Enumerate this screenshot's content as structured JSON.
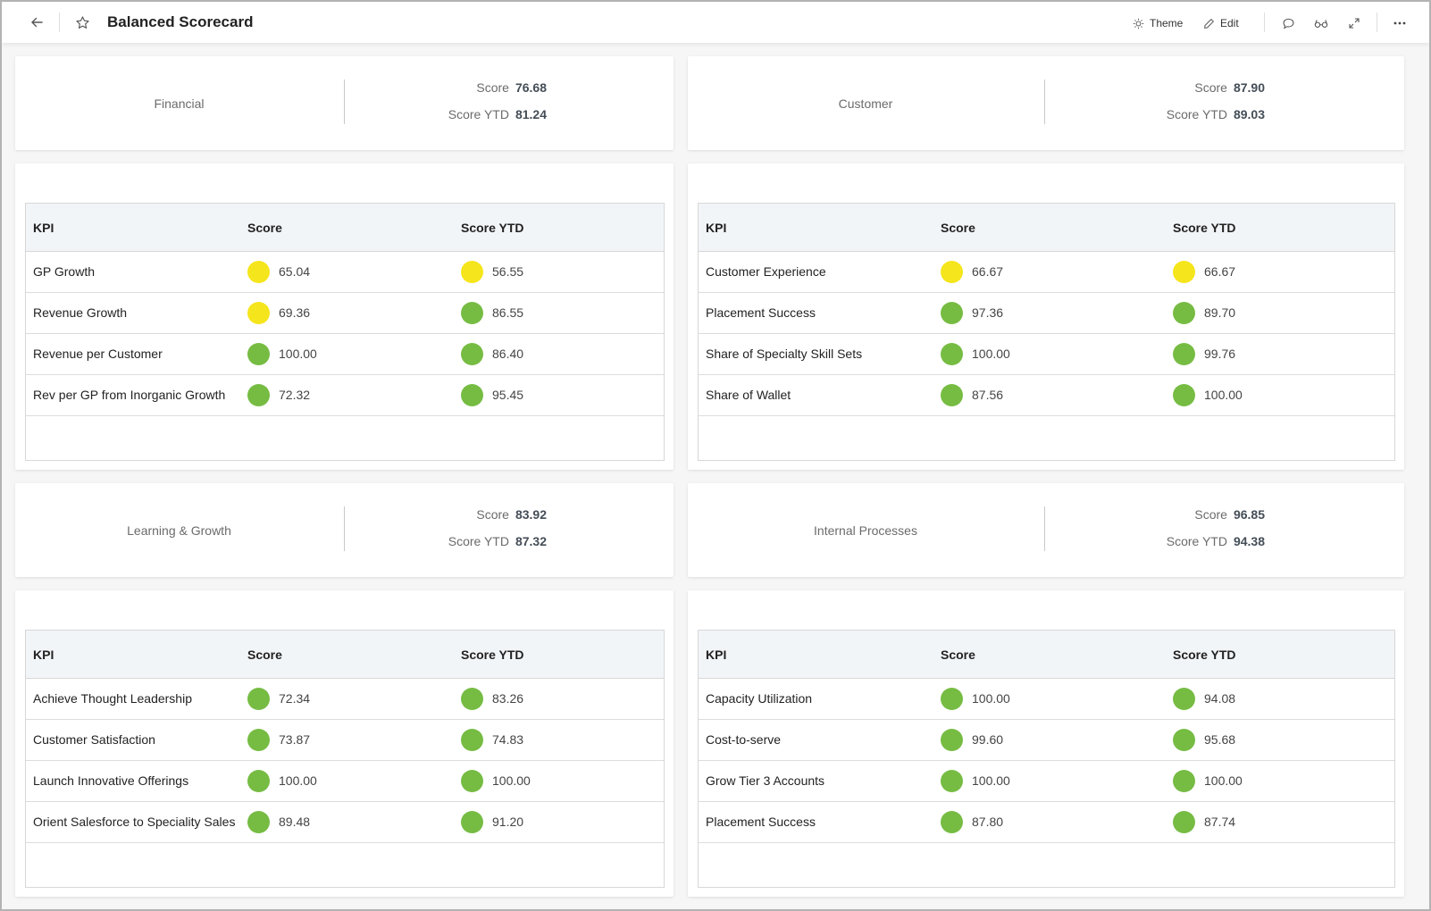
{
  "header": {
    "title": "Balanced Scorecard",
    "back_icon": "arrow-left-icon",
    "favorite_icon": "star-icon",
    "theme_label": "Theme",
    "edit_label": "Edit",
    "icons": [
      "sun-icon",
      "pencil-icon",
      "comment-icon",
      "glasses-icon",
      "expand-icon",
      "more-icon"
    ]
  },
  "colors": {
    "green": "#76bc43",
    "yellow": "#f5e51c",
    "header_bg": "#f2f5f8"
  },
  "columns": [
    "KPI",
    "Score",
    "Score YTD"
  ],
  "summary_labels": {
    "score": "Score",
    "score_ytd": "Score YTD"
  },
  "perspectives": [
    {
      "name": "Financial",
      "score": "76.68",
      "score_ytd": "81.24",
      "rows": [
        {
          "kpi": "GP Growth",
          "score": "65.04",
          "score_status": "yellow",
          "ytd": "56.55",
          "ytd_status": "yellow"
        },
        {
          "kpi": "Revenue Growth",
          "score": "69.36",
          "score_status": "yellow",
          "ytd": "86.55",
          "ytd_status": "green"
        },
        {
          "kpi": "Revenue per Customer",
          "score": "100.00",
          "score_status": "green",
          "ytd": "86.40",
          "ytd_status": "green"
        },
        {
          "kpi": "Rev per GP from Inorganic Growth",
          "score": "72.32",
          "score_status": "green",
          "ytd": "95.45",
          "ytd_status": "green"
        }
      ]
    },
    {
      "name": "Customer",
      "score": "87.90",
      "score_ytd": "89.03",
      "rows": [
        {
          "kpi": "Customer Experience",
          "score": "66.67",
          "score_status": "yellow",
          "ytd": "66.67",
          "ytd_status": "yellow"
        },
        {
          "kpi": "Placement Success",
          "score": "97.36",
          "score_status": "green",
          "ytd": "89.70",
          "ytd_status": "green"
        },
        {
          "kpi": "Share of Specialty Skill Sets",
          "score": "100.00",
          "score_status": "green",
          "ytd": "99.76",
          "ytd_status": "green"
        },
        {
          "kpi": "Share of Wallet",
          "score": "87.56",
          "score_status": "green",
          "ytd": "100.00",
          "ytd_status": "green"
        }
      ]
    },
    {
      "name": "Learning & Growth",
      "score": "83.92",
      "score_ytd": "87.32",
      "rows": [
        {
          "kpi": "Achieve Thought Leadership",
          "score": "72.34",
          "score_status": "green",
          "ytd": "83.26",
          "ytd_status": "green"
        },
        {
          "kpi": "Customer Satisfaction",
          "score": "73.87",
          "score_status": "green",
          "ytd": "74.83",
          "ytd_status": "green"
        },
        {
          "kpi": "Launch Innovative Offerings",
          "score": "100.00",
          "score_status": "green",
          "ytd": "100.00",
          "ytd_status": "green"
        },
        {
          "kpi": "Orient Salesforce to Speciality Sales",
          "score": "89.48",
          "score_status": "green",
          "ytd": "91.20",
          "ytd_status": "green"
        }
      ]
    },
    {
      "name": "Internal Processes",
      "score": "96.85",
      "score_ytd": "94.38",
      "rows": [
        {
          "kpi": "Capacity Utilization",
          "score": "100.00",
          "score_status": "green",
          "ytd": "94.08",
          "ytd_status": "green"
        },
        {
          "kpi": "Cost-to-serve",
          "score": "99.60",
          "score_status": "green",
          "ytd": "95.68",
          "ytd_status": "green"
        },
        {
          "kpi": "Grow Tier 3 Accounts",
          "score": "100.00",
          "score_status": "green",
          "ytd": "100.00",
          "ytd_status": "green"
        },
        {
          "kpi": "Placement Success",
          "score": "87.80",
          "score_status": "green",
          "ytd": "87.74",
          "ytd_status": "green"
        }
      ]
    }
  ]
}
